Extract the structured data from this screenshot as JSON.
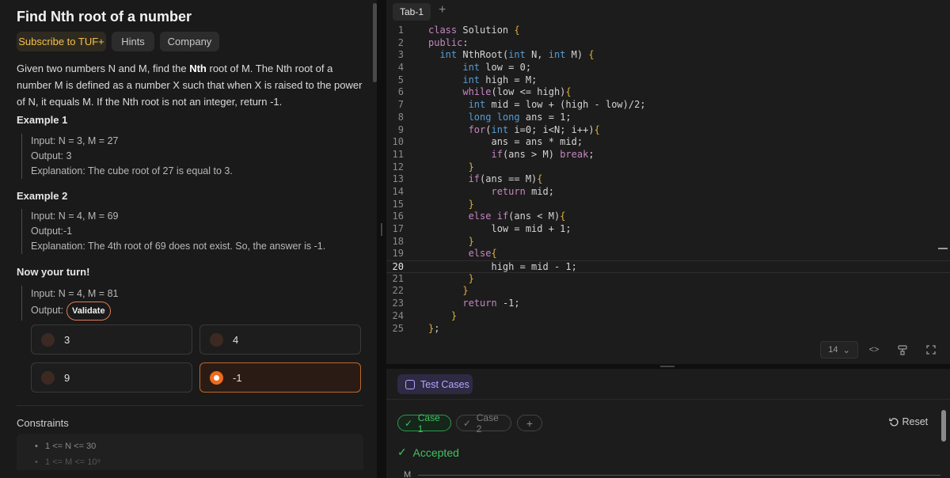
{
  "problem": {
    "title": "Find Nth root of a number",
    "tags": [
      "Subscribe to TUF+",
      "Hints",
      "Company"
    ],
    "desc_part1": "Given two numbers N and M, find the ",
    "desc_bold": "Nth",
    "desc_part2": " root of M. The Nth root of a number M is defined as a number X such that when X is raised to the power of N, it equals M. If the Nth root is not an integer, return -1.",
    "example1_title": "Example 1",
    "example1": [
      "Input: N = 3, M = 27",
      "Output: 3",
      "Explanation: The cube root of 27 is equal to 3."
    ],
    "example2_title": "Example 2",
    "example2": [
      "Input: N = 4, M = 69",
      "Output:-1",
      "Explanation: The 4th root of 69 does not exist. So, the answer is -1."
    ],
    "turn_title": "Now your turn!",
    "turn_input": "Input: N = 4, M = 81",
    "turn_output": "Output:",
    "validate": "Validate",
    "options": [
      "3",
      "4",
      "9",
      "-1"
    ],
    "selected_option": "-1",
    "constraints_title": "Constraints",
    "constraints": [
      "1 <= N <= 30",
      "1 <= M <= 10⁹"
    ]
  },
  "editor": {
    "tab": "Tab-1",
    "add_tab": "+",
    "font_size": "14",
    "current_line": 20,
    "lines": [
      "class Solution {",
      "public:",
      "  int NthRoot(int N, int M) {",
      "      int low = 0;",
      "      int high = M;",
      "      while(low <= high){",
      "       int mid = low + (high - low)/2;",
      "       long long ans = 1;",
      "       for(int i=0; i<N; i++){",
      "           ans = ans * mid;",
      "           if(ans > M) break;",
      "       }",
      "       if(ans == M){",
      "           return mid;",
      "       }",
      "       else if(ans < M){",
      "           low = mid + 1;",
      "       }",
      "       else{",
      "           high = mid - 1;",
      "       }",
      "      }",
      "      return -1;",
      "    }",
      "};"
    ]
  },
  "tests": {
    "tab": "Test Cases",
    "cases": [
      "Case 1",
      "Case 2"
    ],
    "reset": "Reset",
    "status": "Accepted",
    "var_label": "M"
  },
  "colors": {
    "accent": "#ef6a1f",
    "success": "#3fc25f",
    "purple": "#b7a6ff",
    "tuf": "#f5c04a"
  }
}
